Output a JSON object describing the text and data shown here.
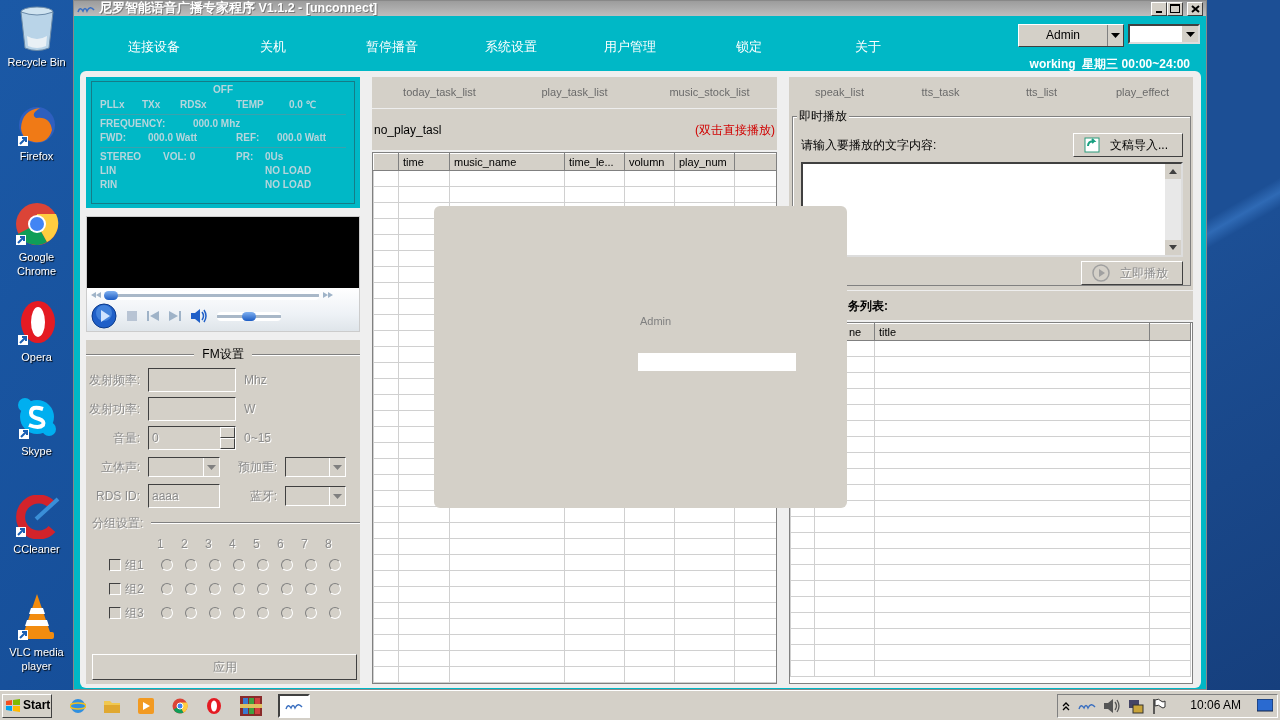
{
  "desktop_icons": [
    {
      "label": "Recycle Bin",
      "kind": "bin"
    },
    {
      "label": "Firefox",
      "kind": "fox"
    },
    {
      "label": "Google Chrome",
      "kind": "chrome"
    },
    {
      "label": "Opera",
      "kind": "ring"
    },
    {
      "label": "Skype",
      "kind": "cloud"
    },
    {
      "label": "CCleaner",
      "kind": "brush"
    },
    {
      "label": "VLC media player",
      "kind": "cone"
    }
  ],
  "window": {
    "title": "尼罗智能语音广播专家程序 V1.1.2 - [unconnect]"
  },
  "menu": [
    "连接设备",
    "关机",
    "暂停播音",
    "系统设置",
    "用户管理",
    "锁定",
    "关于"
  ],
  "user_select": {
    "value": "Admin"
  },
  "status": "working  星期三 00:00~24:00",
  "monitor": {
    "state": "OFF",
    "groups": [
      [
        [
          "PLLx",
          "TXx",
          "RDSx",
          "TEMP",
          "0.0 ℃"
        ]
      ],
      [
        [
          "FREQUENCY:",
          "000.0 Mhz"
        ],
        [
          "FWD:",
          "000.0 Watt",
          "REF:",
          "000.0 Watt"
        ]
      ],
      [
        [
          "STEREO",
          "VOL: 0",
          "PR:",
          "0Us"
        ],
        [
          "LIN",
          "NO LOAD"
        ],
        [
          "RIN",
          "NO LOAD"
        ]
      ]
    ]
  },
  "player": {
    "seek": {
      "level": 0.03
    },
    "volume": {
      "level": 0.5
    }
  },
  "fm_settings": {
    "title": "FM设置",
    "disabled": true,
    "frequency": {
      "label": "发射频率:",
      "unit": "Mhz"
    },
    "power": {
      "label": "发射功率:",
      "unit": "W"
    },
    "volume": {
      "label": "音量:",
      "value": "0",
      "range": "0~15"
    },
    "stereo": {
      "label": "立体声:"
    },
    "pre_emphasis": {
      "label": "预加重:"
    },
    "rds_id": {
      "label": "RDS ID:",
      "value": "aaaa"
    },
    "bluetooth": {
      "label": "蓝牙:"
    },
    "group_label": "分组设置:",
    "channel_numbers": [
      "1",
      "2",
      "3",
      "4",
      "5",
      "6",
      "7",
      "8"
    ],
    "groups": [
      {
        "label": "组1",
        "checked": false,
        "channels": [
          {
            "selected": false
          },
          {
            "selected": false
          },
          {
            "selected": false
          },
          {
            "selected": false
          },
          {
            "selected": false
          },
          {
            "selected": false
          },
          {
            "selected": false
          },
          {
            "selected": false
          }
        ]
      },
      {
        "label": "组2",
        "checked": false,
        "channels": [
          {
            "selected": false
          },
          {
            "selected": false
          },
          {
            "selected": false
          },
          {
            "selected": false
          },
          {
            "selected": false
          },
          {
            "selected": false
          },
          {
            "selected": false
          },
          {
            "selected": false
          }
        ]
      },
      {
        "label": "组3",
        "checked": false,
        "channels": [
          {
            "selected": false
          },
          {
            "selected": false
          },
          {
            "selected": false
          },
          {
            "selected": false
          },
          {
            "selected": false
          },
          {
            "selected": false
          },
          {
            "selected": false
          },
          {
            "selected": false
          }
        ]
      }
    ],
    "apply_button": "应用"
  },
  "task_panel": {
    "tabs": [
      {
        "label": "today_task_list",
        "selected": false
      },
      {
        "label": "play_task_list",
        "selected": false
      },
      {
        "label": "music_stock_list",
        "selected": false
      }
    ],
    "task_label": "no_play_tasl",
    "hint": "(双击直接播放)",
    "columns": [
      "time",
      "music_name",
      "time_le...",
      "volumn",
      "play_num"
    ]
  },
  "speak_panel": {
    "tabs": [
      {
        "label": "speak_list",
        "selected": false
      },
      {
        "label": "tts_task",
        "selected": false
      },
      {
        "label": "tts_list",
        "selected": false
      },
      {
        "label": "play_effect",
        "selected": false
      }
    ],
    "group_title": "即时播放",
    "prompt": "请输入要播放的文字内容:",
    "import_button": "文稿导入...",
    "play_button": {
      "label": "立即播放",
      "disabled": true
    },
    "list_label": "务列表:",
    "columns": [
      "ne",
      "title"
    ]
  },
  "dialog": {
    "label": "Admin"
  },
  "taskbar": {
    "start": "Start",
    "time": "10:06 AM"
  }
}
